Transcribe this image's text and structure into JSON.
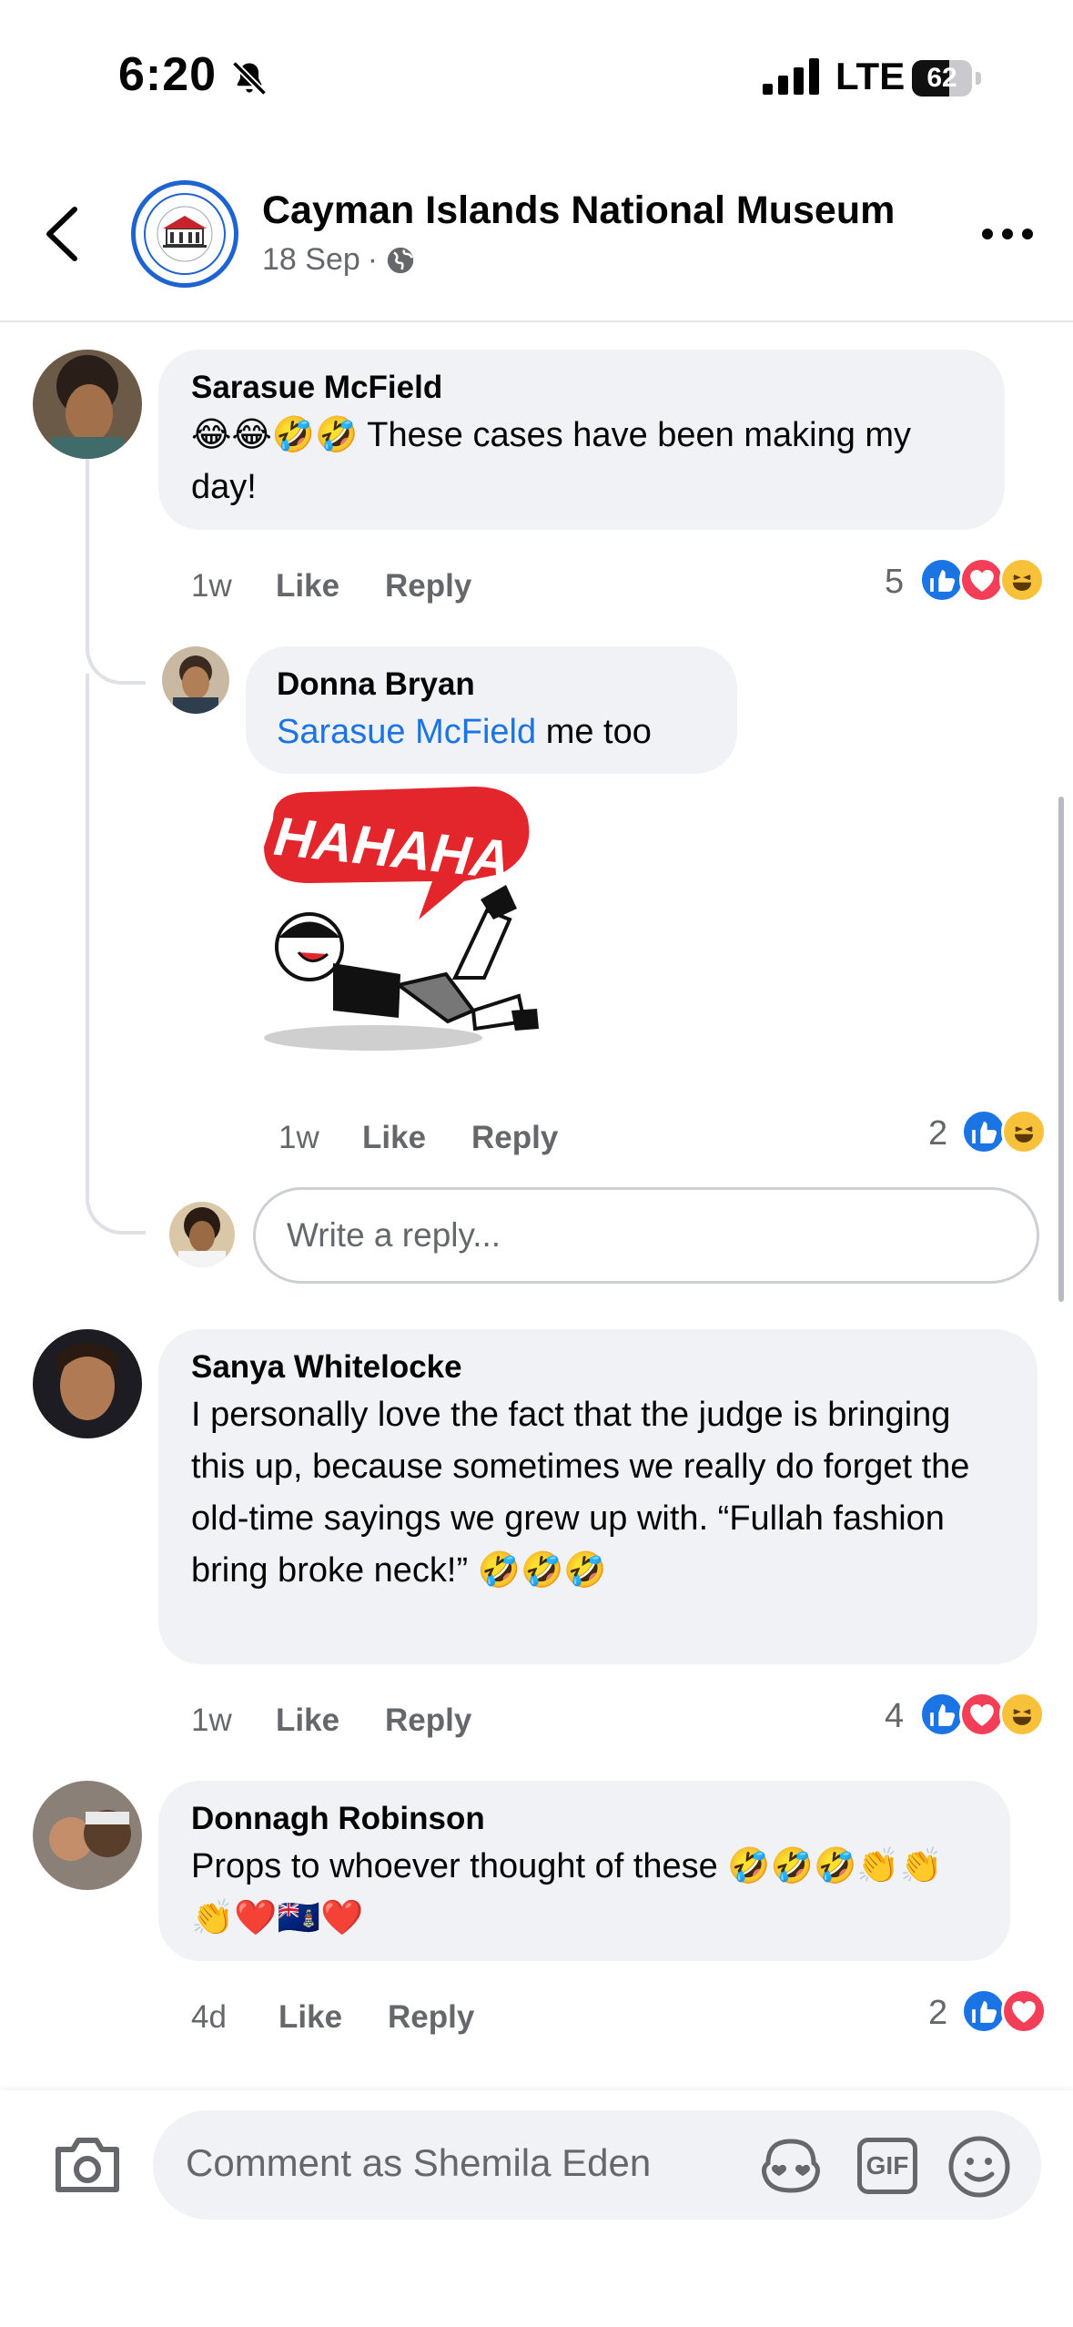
{
  "status_bar": {
    "time": "6:20",
    "network": "LTE",
    "battery": "62",
    "battery_level": 0.62
  },
  "header": {
    "page_name": "Cayman Islands National Museum",
    "date": "18 Sep",
    "separator": "·",
    "logo_icon": "museum-logo",
    "more_icon": "more-horizontal-icon"
  },
  "comments": [
    {
      "author": "Sarasue McField",
      "text": "😂😂🤣🤣 These cases have been making my day!",
      "age": "1w",
      "like_label": "Like",
      "reply_label": "Reply",
      "reaction_count": "5",
      "reactions": [
        "like",
        "love",
        "haha"
      ],
      "replies": [
        {
          "author": "Donna Bryan",
          "mention": "Sarasue McField",
          "text": "me too",
          "sticker_text": "HAHAHA",
          "age": "1w",
          "like_label": "Like",
          "reply_label": "Reply",
          "reaction_count": "2",
          "reactions": [
            "like",
            "haha"
          ]
        }
      ],
      "reply_placeholder": "Write a reply..."
    },
    {
      "author": "Sanya Whitelocke",
      "text": "I personally love the fact that the judge is bringing this up, because sometimes we really do forget the old-time sayings we grew up with. “Fullah fashion bring broke neck!” 🤣🤣🤣",
      "age": "1w",
      "like_label": "Like",
      "reply_label": "Reply",
      "reaction_count": "4",
      "reactions": [
        "like",
        "love",
        "haha"
      ]
    },
    {
      "author": "Donnagh Robinson",
      "text": "Props to whoever thought of these 🤣🤣🤣👏👏👏❤️🇰🇾❤️",
      "age": "4d",
      "like_label": "Like",
      "reply_label": "Reply",
      "reaction_count": "2",
      "reactions": [
        "like",
        "love"
      ]
    }
  ],
  "composer": {
    "placeholder": "Comment as Shemila Eden",
    "gif_label": "GIF"
  },
  "colors": {
    "accent": "#1b74e4",
    "love": "#f33e58",
    "haha": "#f7c23a",
    "bubble": "#f0f2f5",
    "muted": "#65676b"
  }
}
